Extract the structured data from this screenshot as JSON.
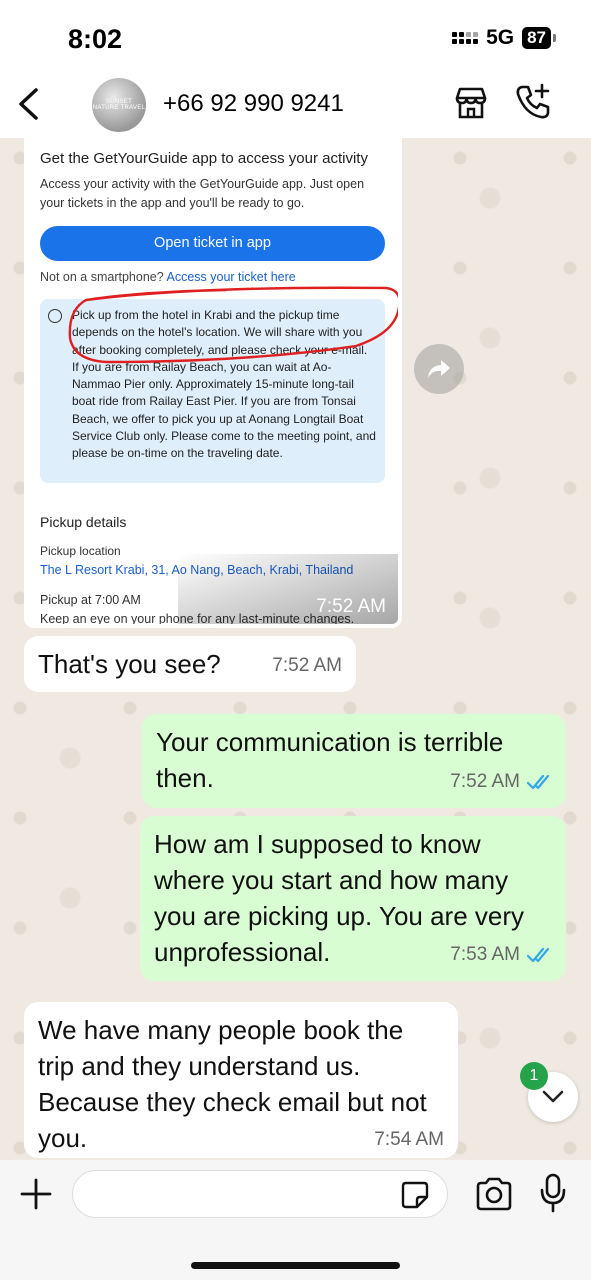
{
  "status_bar": {
    "time": "8:02",
    "network": "5G",
    "battery": "87"
  },
  "header": {
    "contact_name": "+66 92 990 9241",
    "avatar_text": "SUNSET NATURE TRAVEL"
  },
  "image_message": {
    "title": "Get the GetYourGuide app to access your activity",
    "description": "Access your activity with the GetYourGuide app. Just open your tickets in the app and you'll be ready to go.",
    "button_label": "Open ticket in app",
    "smartphone_prefix": "Not on a smartphone?",
    "smartphone_link": "Access your ticket here",
    "info_text": "Pick up from the hotel in Krabi and the pickup time depends on the hotel's location. We will share with you after booking completely, and please check your e-mail. If you are from Railay Beach, you can wait at Ao-Nammao Pier only. Approximately 15-minute long-tail boat ride from Railay East Pier. If you are from Tonsai Beach, we offer to pick you up at Aonang Longtail Boat Service Club only. Please come to the meeting point, and please be on-time on the traveling date.",
    "pickup_heading": "Pickup details",
    "pickup_location_label": "Pickup location",
    "pickup_location": "The L Resort Krabi, 31, Ao Nang, Beach, Krabi, Thailand",
    "pickup_time": "Pickup at 7:00 AM",
    "keep_eye": "Keep an eye on your phone for any last-minute changes.",
    "timestamp": "7:52 AM"
  },
  "messages": [
    {
      "direction": "in",
      "text": "That's you see?",
      "time": "7:52 AM"
    },
    {
      "direction": "out",
      "text": "Your communication is terrible then.",
      "time": "7:52 AM",
      "status": "read"
    },
    {
      "direction": "out",
      "text": "How am I supposed to know where you start and how many you are picking up. You are very unprofessional.",
      "time": "7:53 AM",
      "status": "read"
    },
    {
      "direction": "in",
      "text": "We have many people book the trip and they understand us. Because they check email but not you.",
      "time": "7:54 AM"
    }
  ],
  "unread_count": "1",
  "composer": {
    "value": "",
    "placeholder": ""
  },
  "colors": {
    "outgoing_bubble": "#d9fdd3",
    "incoming_bubble": "#ffffff",
    "read_tick": "#34a7e8",
    "unread_badge": "#25a34a",
    "gyg_button": "#1a73e8"
  },
  "icons": [
    "back-chevron-icon",
    "store-icon",
    "add-call-icon",
    "forward-icon",
    "chevron-down-icon",
    "plus-icon",
    "sticker-icon",
    "camera-icon",
    "microphone-icon"
  ]
}
